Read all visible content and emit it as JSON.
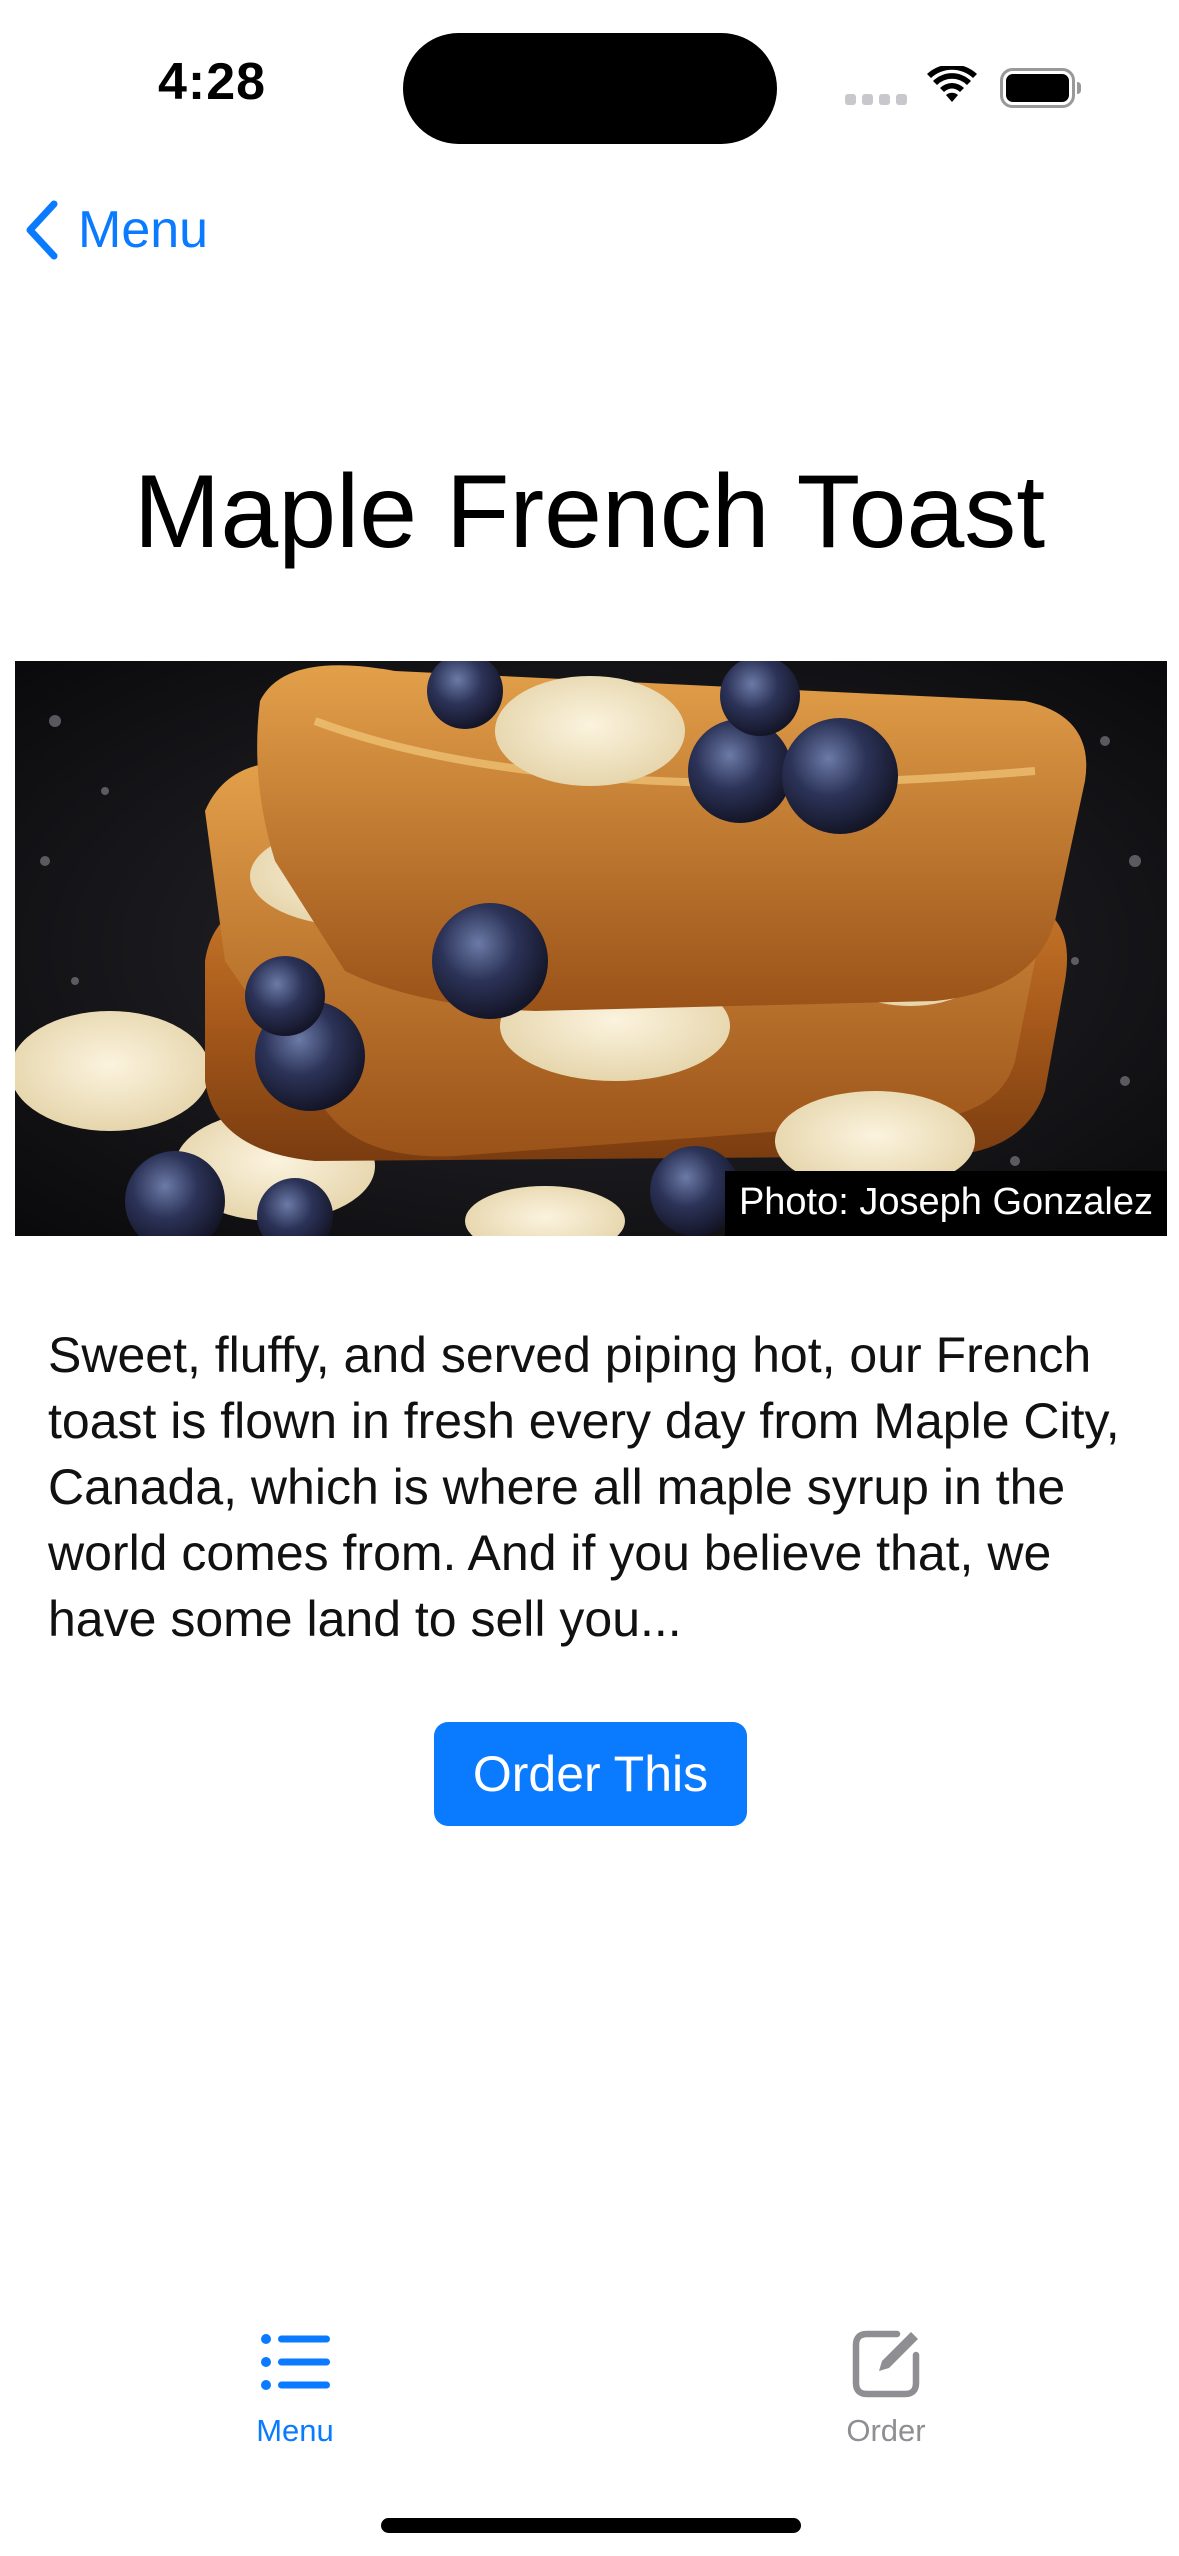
{
  "status_bar": {
    "time": "4:28"
  },
  "nav": {
    "back_label": "Menu",
    "back_icon": "chevron-left-icon",
    "accent_color": "#0a7aff"
  },
  "item": {
    "title": "Maple French Toast",
    "photo_credit": "Photo: Joseph Gonzalez",
    "description": "Sweet, fluffy, and served piping hot, our French toast is flown in fresh every day from Maple City, Canada, which is where all maple syrup in the world comes from. And if you believe that, we have some land to sell you...",
    "order_button_label": "Order This"
  },
  "tab_bar": {
    "tabs": [
      {
        "label": "Menu",
        "icon": "list-icon",
        "selected": true
      },
      {
        "label": "Order",
        "icon": "square-pencil-icon",
        "selected": false
      }
    ],
    "active_color": "#0a7aff",
    "inactive_color": "#8e8e93"
  }
}
